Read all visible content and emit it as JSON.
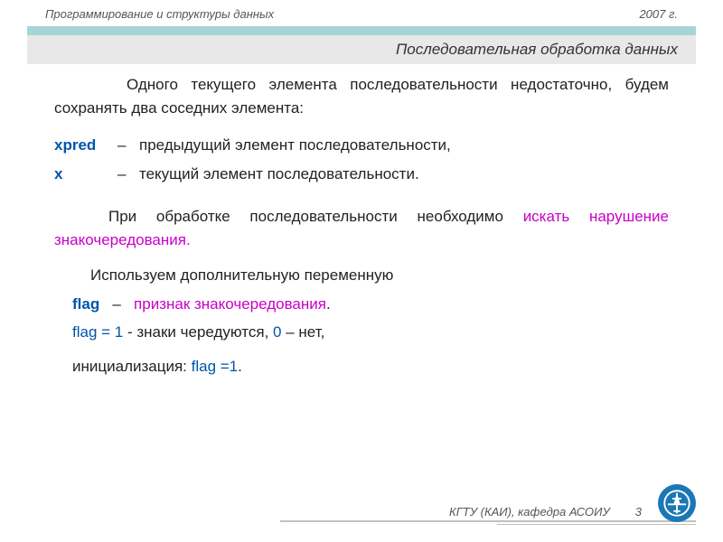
{
  "header": {
    "left": "Программирование  и структуры данных",
    "right": "2007 г."
  },
  "title": "Последовательная обработка данных",
  "para1": "Одного текущего элемента последовательности недостаточно, будем сохранять два соседних элемента:",
  "defs": [
    {
      "term": "xpred",
      "desc": "предыдущий элемент последовательности,"
    },
    {
      "term": "x",
      "desc": "текущий элемент последовательности."
    }
  ],
  "para2_a": "При обработке последовательности необходимо ",
  "para2_b": "искать нарушение знакочередования.",
  "para3": "Используем дополнительную переменную",
  "flag": {
    "name": "flag",
    "dash": "–",
    "desc": "признак  знакочередования",
    "pt": ".",
    "eq1_a": "flag = 1",
    "eq1_b": " -  знаки  чередуются, ",
    "eq1_c": "0",
    "eq1_d": " – нет,",
    "init_a": "инициализация: ",
    "init_b": "flag =1",
    "init_c": "."
  },
  "footer": {
    "org": "КГТУ  (КАИ),  кафедра АСОИУ",
    "page": "3"
  }
}
